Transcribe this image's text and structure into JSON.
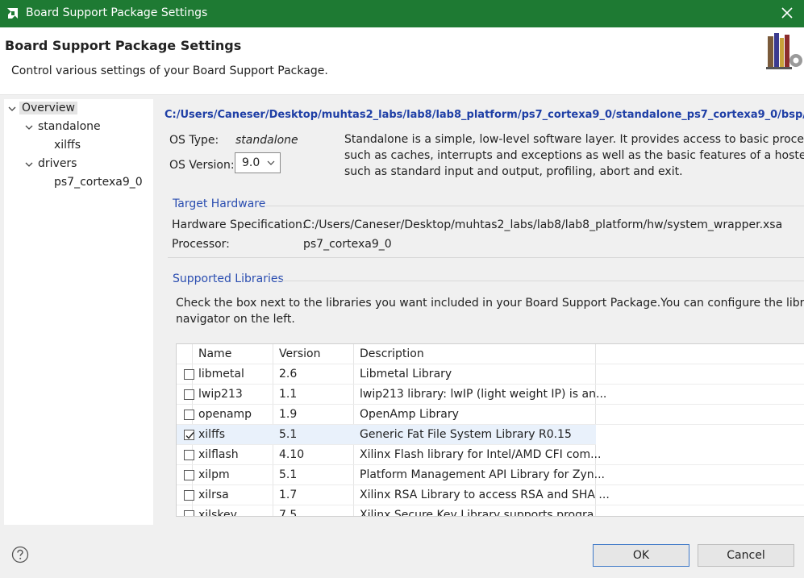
{
  "window": {
    "title": "Board Support Package Settings",
    "titlebar_color": "#1e7a33"
  },
  "header": {
    "title": "Board Support Package Settings",
    "subtitle": "Control various settings of your Board Support Package."
  },
  "tree": {
    "overview": "Overview",
    "standalone": "standalone",
    "xilffs": "xilffs",
    "drivers": "drivers",
    "ps7": "ps7_cortexa9_0"
  },
  "overview": {
    "path": "C:/Users/Caneser/Desktop/muhtas2_labs/lab8/lab8_platform/ps7_cortexa9_0/standalone_ps7_cortexa9_0/bsp/s",
    "os_type_label": "OS Type:",
    "os_type_value": "standalone",
    "os_version_label": "OS Version:",
    "os_version_value": "9.0",
    "description_lines": [
      "Standalone is a simple, low-level software layer. It provides access to basic processor",
      "such as caches, interrupts and exceptions as well as the basic features of a hosted env",
      "such as standard input and output, profiling, abort and exit."
    ]
  },
  "target_hardware": {
    "title": "Target Hardware",
    "hw_spec_label": "Hardware Specification:",
    "hw_spec_value": "C:/Users/Caneser/Desktop/muhtas2_labs/lab8/lab8_platform/hw/system_wrapper.xsa",
    "processor_label": "Processor:",
    "processor_value": "ps7_cortexa9_0"
  },
  "libraries": {
    "title": "Supported Libraries",
    "instructions_lines": [
      "Check the box next to the libraries you want included in your Board Support Package.You can configure the library in t",
      "navigator on the left."
    ],
    "columns": [
      "Name",
      "Version",
      "Description"
    ],
    "rows": [
      {
        "name": "libmetal",
        "version": "2.6",
        "description": "Libmetal Library",
        "checked": false
      },
      {
        "name": "lwip213",
        "version": "1.1",
        "description": "lwip213 library: lwIP (light weight IP) is an...",
        "checked": false
      },
      {
        "name": "openamp",
        "version": "1.9",
        "description": "OpenAmp Library",
        "checked": false
      },
      {
        "name": "xilffs",
        "version": "5.1",
        "description": "Generic Fat File System Library R0.15",
        "checked": true
      },
      {
        "name": "xilflash",
        "version": "4.10",
        "description": "Xilinx Flash library for Intel/AMD CFI com...",
        "checked": false
      },
      {
        "name": "xilpm",
        "version": "5.1",
        "description": "Platform Management API Library for Zyn...",
        "checked": false
      },
      {
        "name": "xilrsa",
        "version": "1.7",
        "description": "Xilinx RSA Library to access RSA and SHA ...",
        "checked": false
      },
      {
        "name": "xilskey",
        "version": "7.5",
        "description": "Xilinx Secure Key Library supports progra...",
        "checked": false
      }
    ]
  },
  "buttons": {
    "ok": "OK",
    "cancel": "Cancel"
  },
  "icons": {
    "app": "amd-logo-icon",
    "close": "close-icon",
    "banner": "books-gear-icon",
    "help": "help-icon",
    "dropdown": "chevron-down-icon"
  }
}
